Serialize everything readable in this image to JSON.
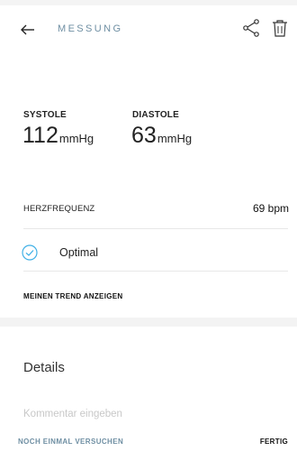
{
  "header": {
    "back_icon": "arrow-left-icon",
    "title": "MESSUNG",
    "share_icon": "share-icon",
    "delete_icon": "trash-icon",
    "title_color": "#6f8fa3"
  },
  "measurement": {
    "systole": {
      "label": "SYSTOLE",
      "value": "112",
      "unit": "mmHg"
    },
    "diastole": {
      "label": "DIASTOLE",
      "value": "63",
      "unit": "mmHg"
    }
  },
  "heart_rate": {
    "label": "HERZFREQUENZ",
    "value": "69 bpm"
  },
  "status": {
    "icon": "check-circle-icon",
    "label": "Optimal",
    "color": "#3fb0e6"
  },
  "trend": {
    "label": "MEINEN TREND ANZEIGEN"
  },
  "details": {
    "heading": "Details",
    "comment_placeholder": "Kommentar eingeben",
    "comment_value": ""
  },
  "footer": {
    "retry_label": "NOCH EINMAL VERSUCHEN",
    "done_label": "FERTIG"
  }
}
